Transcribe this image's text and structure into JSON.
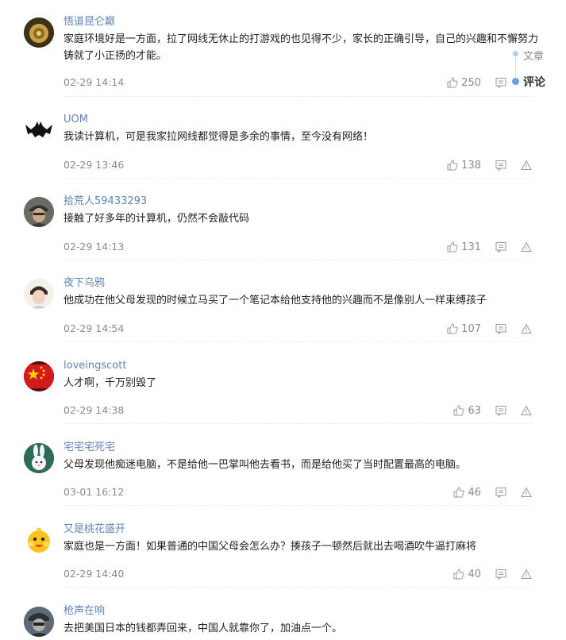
{
  "sidenav": {
    "article_label": "文章",
    "comment_label": "评论"
  },
  "comments": [
    {
      "username": "悟道昆仑巅",
      "content": "家庭环境好是一方面，拉了网线无休止的打游戏的也见得不少，家长的正确引导，自己的兴趣和不懈努力铸就了小正扬的才能。",
      "time": "02-29 14:14",
      "likes": "250",
      "avatar": "gold-medallion"
    },
    {
      "username": "UOM",
      "content": "我读计算机，可是我家拉网线都觉得是多余的事情，至今没有网络！",
      "time": "02-29 13:46",
      "likes": "138",
      "avatar": "black-bat"
    },
    {
      "username": "拾荒人59433293",
      "content": "接触了好多年的计算机，仍然不会敲代码",
      "time": "02-29 14:13",
      "likes": "131",
      "avatar": "man-with-cap"
    },
    {
      "username": "夜下乌鸦",
      "content": "他成功在他父母发现的时候立马买了一个笔记本给他支持他的兴趣而不是像别人一样束缚孩子",
      "time": "02-29 14:54",
      "likes": "107",
      "avatar": "young-man"
    },
    {
      "username": "loveingscott",
      "content": "人才啊，千万别毁了",
      "time": "02-29 14:38",
      "likes": "63",
      "avatar": "china-flag"
    },
    {
      "username": "宅宅宅死宅",
      "content": "父母发现他痴迷电脑，不是给他一巴掌叫他去看书，而是给他买了当时配置最高的电脑。",
      "time": "03-01 16:12",
      "likes": "46",
      "avatar": "white-rabbit"
    },
    {
      "username": "又是桃花盛开",
      "content": "家庭也是一方面！如果普通的中国父母会怎么办？揍孩子一顿然后就出去喝酒吹牛逼打麻将",
      "time": "02-29 14:40",
      "likes": "40",
      "avatar": "yellow-chick"
    },
    {
      "username": "枪声在响",
      "content": "去把美国日本的钱都弄回来，中国人就靠你了，加油点一个。",
      "time": "",
      "likes": "",
      "avatar": "soldier"
    }
  ]
}
